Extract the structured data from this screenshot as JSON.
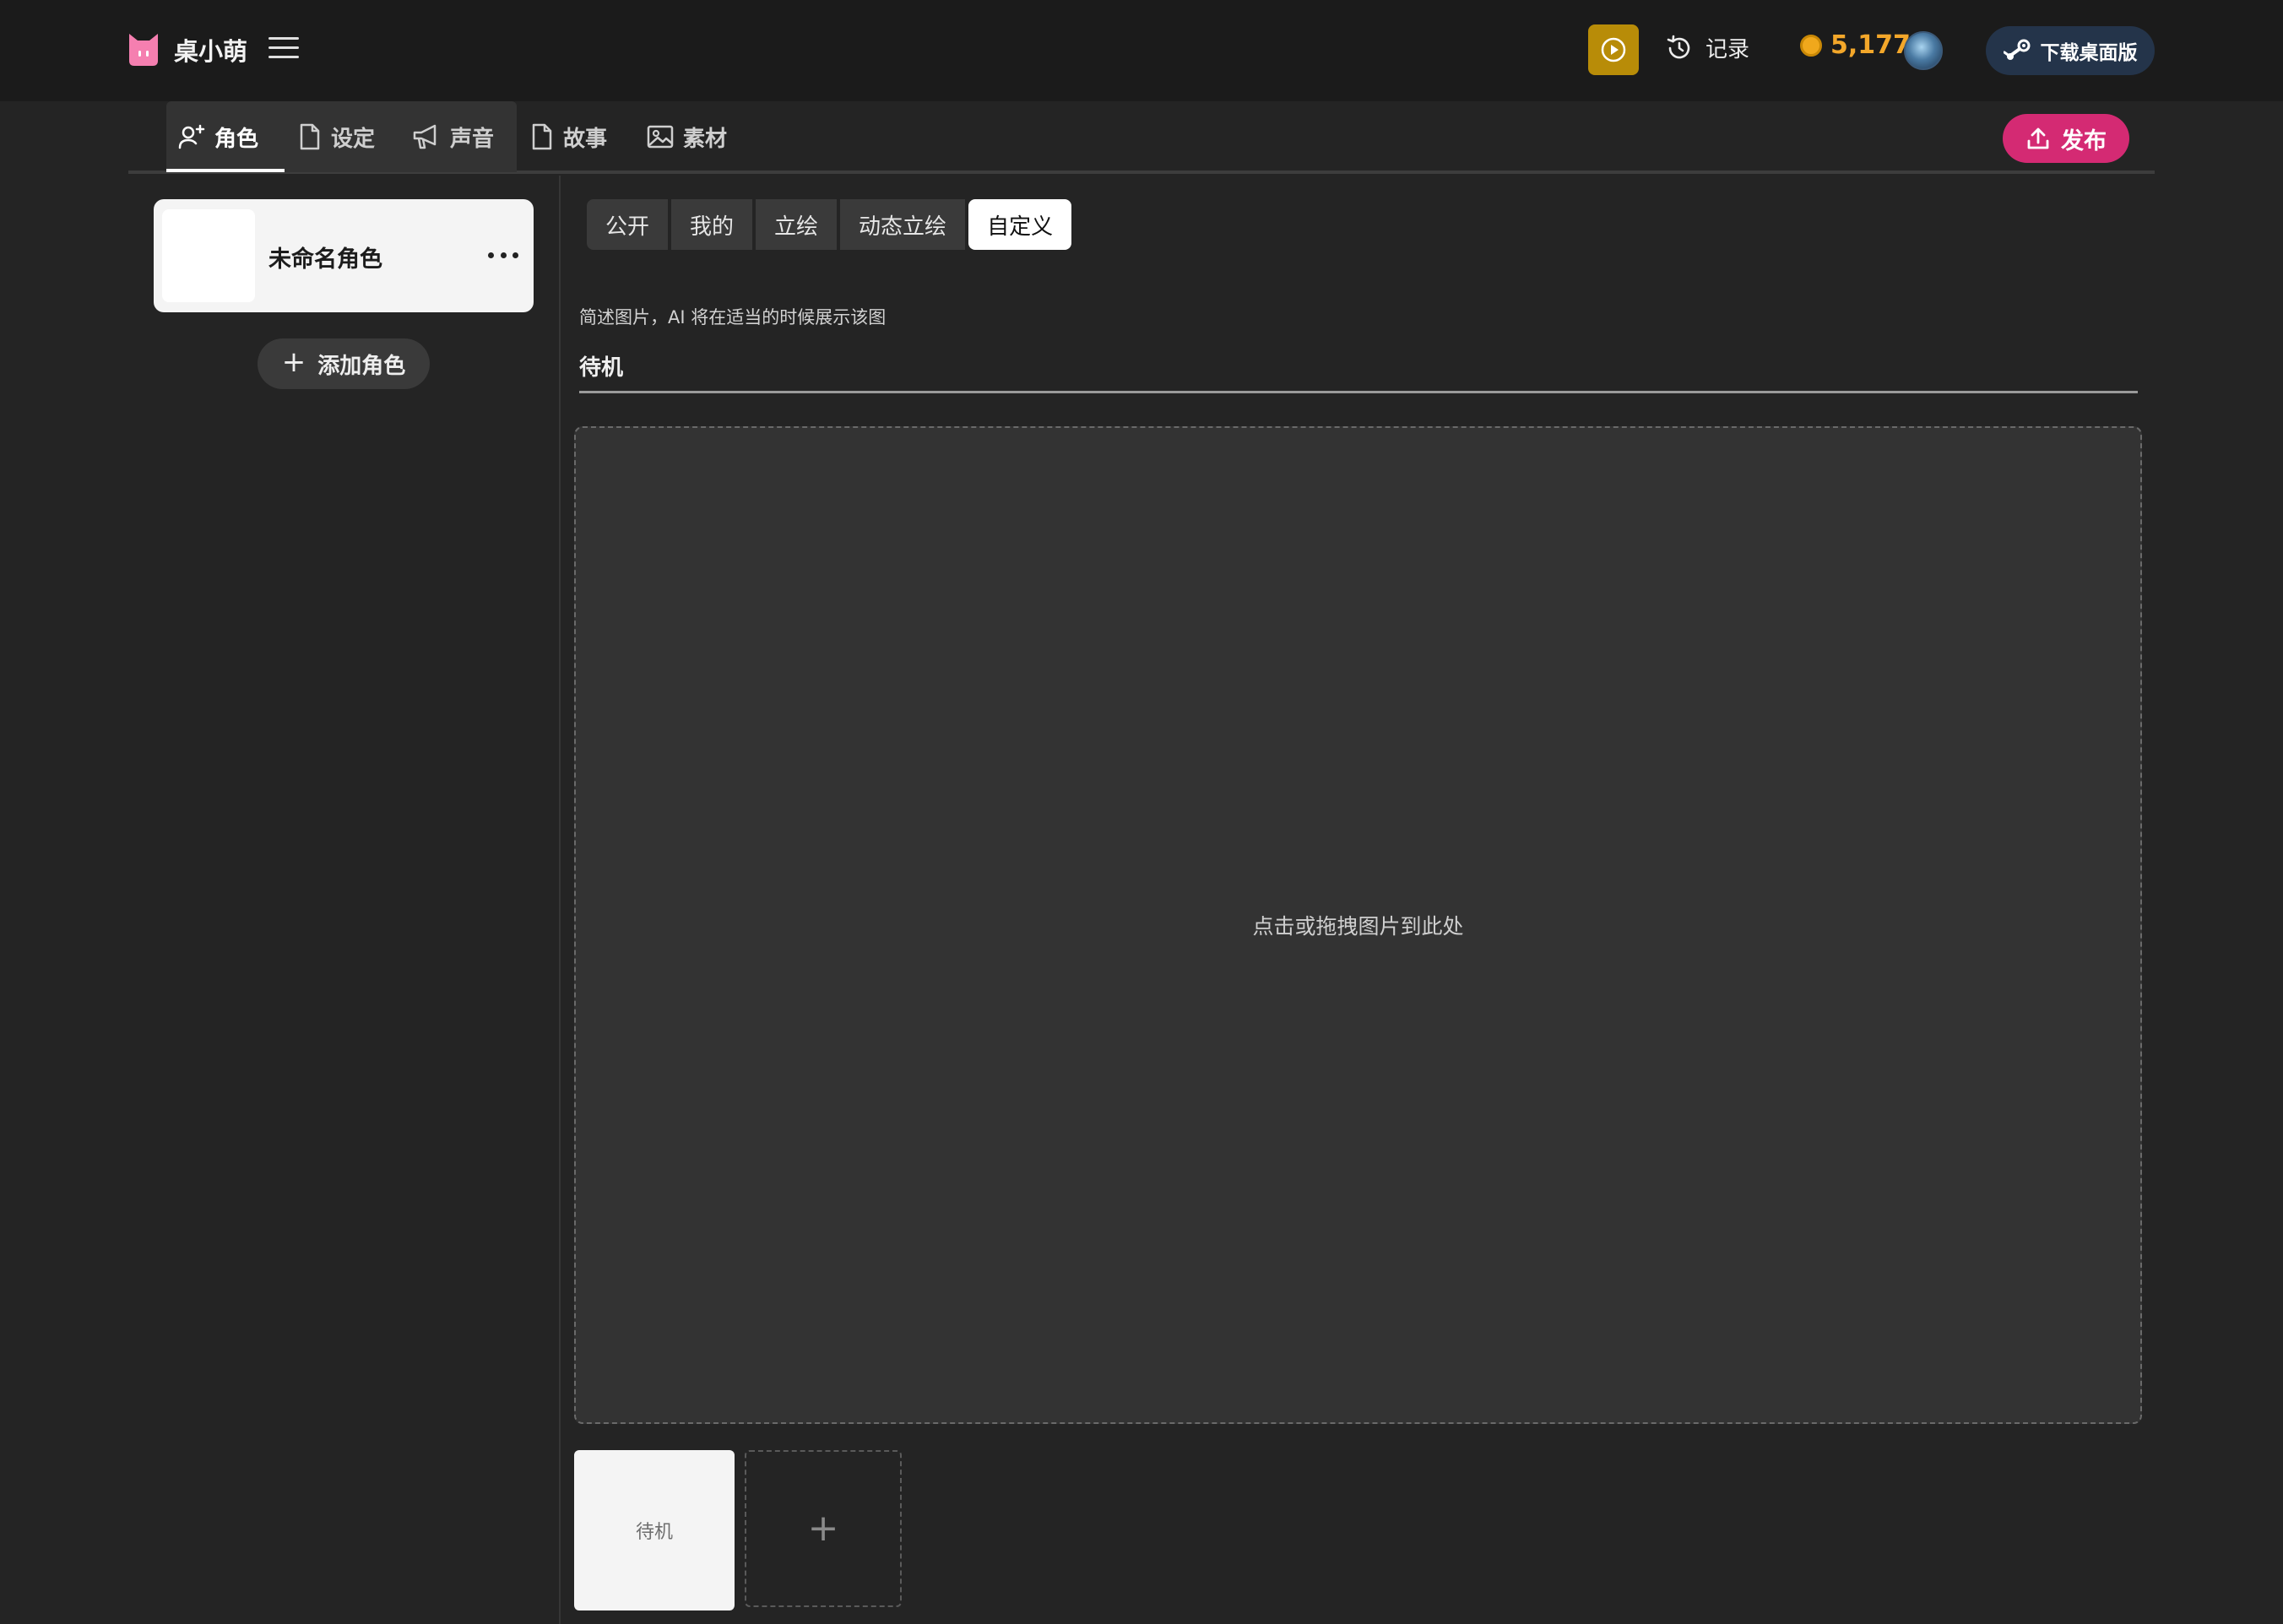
{
  "header": {
    "app_title": "桌小萌",
    "history_label": "记录",
    "coins": "5,177",
    "download_label": "下载桌面版"
  },
  "tabs": [
    {
      "label": "角色",
      "icon": "user-plus-icon",
      "active": true
    },
    {
      "label": "设定",
      "icon": "document-icon"
    },
    {
      "label": "声音",
      "icon": "megaphone-icon"
    },
    {
      "label": "故事",
      "icon": "document-icon"
    },
    {
      "label": "素材",
      "icon": "image-icon"
    }
  ],
  "publish_label": "发布",
  "sidebar": {
    "character_name": "未命名角色",
    "add_character_label": "添加角色"
  },
  "image_source_tabs": [
    "公开",
    "我的",
    "立绘",
    "动态立绘",
    "自定义"
  ],
  "image_source_active": "自定义",
  "description_hint": "简述图片，AI 将在适当的时候展示该图",
  "image_name_value": "待机",
  "dropzone_label": "点击或拖拽图片到此处",
  "thumbnails": [
    {
      "label": "待机"
    }
  ],
  "colors": {
    "accent_publish": "#d42a73",
    "play_button": "#b88c08",
    "coin": "#f3a72a",
    "background": "#242424",
    "topbar": "#1b1b1b"
  }
}
